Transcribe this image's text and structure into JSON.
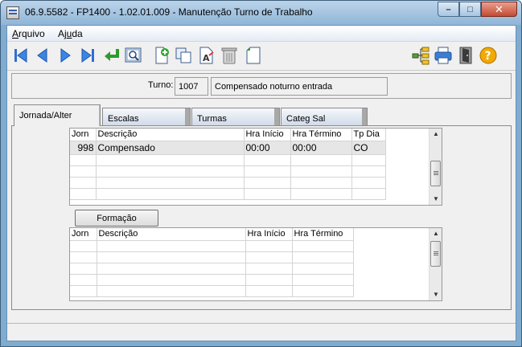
{
  "window": {
    "title": "06.9.5582 - FP1400 - 1.02.01.009 - Manutenção Turno de Trabalho",
    "close_glyph": "✕",
    "maximize_glyph": "□",
    "minimize_glyph": "–"
  },
  "menu": {
    "arquivo_first": "A",
    "arquivo_rest": "rquivo",
    "ajuda_first": "Aj",
    "ajuda_underline": "u",
    "ajuda_rest": "da"
  },
  "toolbar": {
    "icons": [
      "first-record-icon",
      "previous-record-icon",
      "next-record-icon",
      "last-record-icon",
      "return-icon",
      "search-icon",
      "new-record-icon",
      "copy-record-icon",
      "edit-record-icon",
      "delete-record-icon",
      "save-record-icon",
      "hierarchy-icon",
      "print-icon",
      "exit-icon",
      "help-icon"
    ]
  },
  "turno": {
    "label": "Turno:",
    "code": "1007",
    "description": "Compensado noturno entrada"
  },
  "tabs": [
    {
      "label": "Jornada/Alter",
      "active": true
    },
    {
      "label": "Escalas",
      "active": false
    },
    {
      "label": "Turmas",
      "active": false
    },
    {
      "label": "Categ Sal",
      "active": false
    }
  ],
  "jornada_grid": {
    "headers": [
      "Jorn",
      "Descrição",
      "Hra Início",
      "Hra Término",
      "Tp Dia"
    ],
    "rows": [
      [
        "998",
        "Compensado",
        "00:00",
        "00:00",
        "CO"
      ]
    ]
  },
  "formacao_button": "Formação",
  "formacao_grid": {
    "headers": [
      "Jorn",
      "Descrição",
      "Hra Início",
      "Hra Término"
    ]
  },
  "colors": {
    "accent": "#3a7fd5",
    "help": "#f2a900",
    "add": "#2da52d"
  }
}
